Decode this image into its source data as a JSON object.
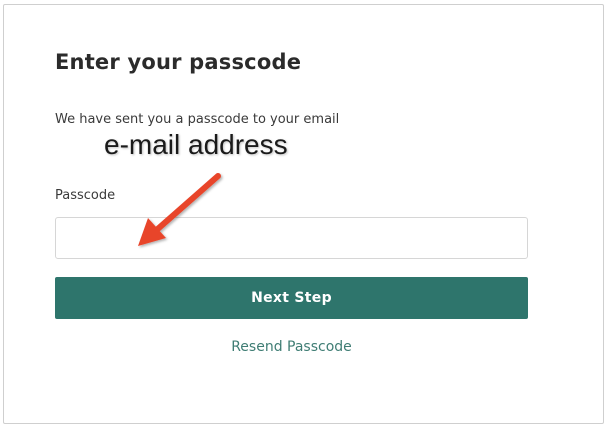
{
  "header": {
    "title": "Enter your passcode"
  },
  "form": {
    "subtitle": "We have sent you a passcode to your email",
    "passcode_label": "Passcode",
    "passcode_value": "",
    "passcode_placeholder": "",
    "next_step_label": "Next Step",
    "resend_label": "Resend Passcode"
  },
  "annotation": {
    "text": "e-mail address",
    "arrow_icon": "arrow-icon",
    "arrow_color": "#e8452b"
  },
  "colors": {
    "primary_button": "#2e756c",
    "link": "#3f7d74"
  }
}
